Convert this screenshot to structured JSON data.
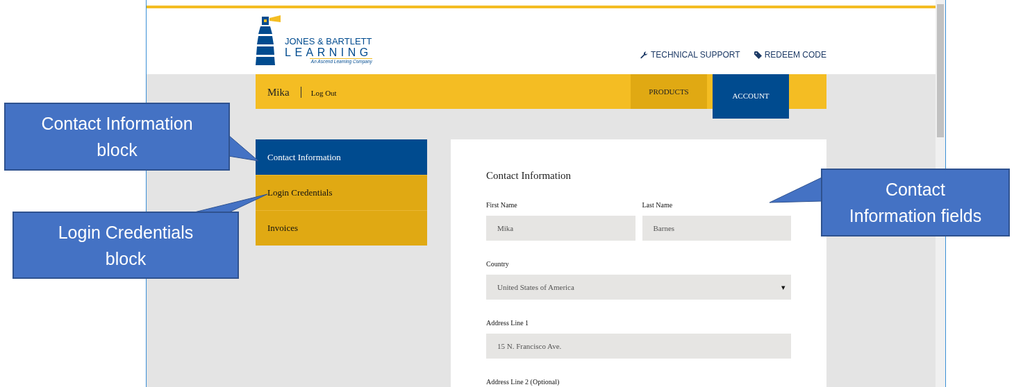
{
  "logo": {
    "line_1": "JONES & BARTLETT",
    "line_2": "LEARNING",
    "tagline": "An Ascend Learning Company"
  },
  "header_links": [
    {
      "kind": "wrench",
      "label": "TECHNICAL SUPPORT"
    },
    {
      "kind": "tag",
      "label": "REDEEM CODE"
    }
  ],
  "nav": {
    "user": "Mika",
    "logout": "Log Out",
    "items": [
      {
        "label": "PRODUCTS",
        "selected": false
      },
      {
        "label": "ACCOUNT",
        "selected": true
      }
    ]
  },
  "sidebar": {
    "items": [
      {
        "label": "Contact Information",
        "selected": true
      },
      {
        "label": "Login Credentials",
        "selected": false
      },
      {
        "label": "Invoices",
        "selected": false
      }
    ]
  },
  "form": {
    "title": "Contact Information",
    "rows": [
      [
        {
          "kind": "text",
          "label": "First Name",
          "value": "Mika"
        },
        {
          "kind": "text",
          "label": "Last Name",
          "value": "Barnes"
        }
      ],
      [
        {
          "kind": "select",
          "label": "Country",
          "value": "United States of America",
          "caret": "▾"
        }
      ],
      [
        {
          "kind": "text",
          "label": "Address Line 1",
          "value": "15 N. Francisco Ave."
        }
      ],
      [
        {
          "kind": "label",
          "label": "Address Line 2 (Optional)"
        }
      ]
    ]
  },
  "callouts": [
    {
      "text": "Contact Information block"
    },
    {
      "text": "Login Credentials block"
    },
    {
      "text": "Contact Information fields"
    }
  ]
}
